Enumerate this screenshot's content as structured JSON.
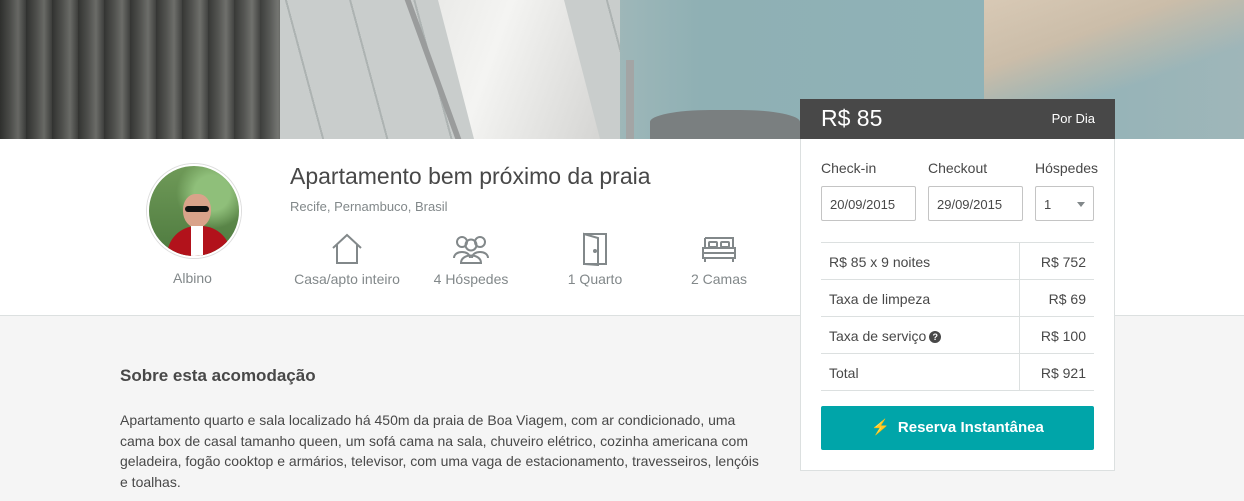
{
  "listing": {
    "title": "Apartamento bem próximo da praia",
    "location": "Recife, Pernambuco, Brasil",
    "host_name": "Albino"
  },
  "amenities": [
    {
      "icon": "house-icon",
      "label": "Casa/apto inteiro"
    },
    {
      "icon": "guests-icon",
      "label": "4 Hóspedes"
    },
    {
      "icon": "door-icon",
      "label": "1 Quarto"
    },
    {
      "icon": "bed-icon",
      "label": "2 Camas"
    }
  ],
  "pricing": {
    "price": "R$ 85",
    "period": "Por Dia"
  },
  "booking": {
    "checkin_label": "Check-in",
    "checkout_label": "Checkout",
    "guests_label": "Hóspedes",
    "checkin_value": "20/09/2015",
    "checkout_value": "29/09/2015",
    "guests_value": "1",
    "rows": [
      {
        "label": "R$ 85 x 9 noites",
        "value": "R$ 752"
      },
      {
        "label": "Taxa de limpeza",
        "value": "R$ 69"
      },
      {
        "label": "Taxa de serviço",
        "value": "R$ 100",
        "help_icon": "?"
      },
      {
        "label": "Total",
        "value": "R$ 921"
      }
    ],
    "button_label": "Reserva Instantânea",
    "button_icon": "lightning-icon",
    "accent_color": "#00a5a9"
  },
  "about": {
    "title": "Sobre esta acomodação",
    "text": "Apartamento quarto e sala localizado há 450m da praia de Boa Viagem, com ar condicionado, uma cama box de casal tamanho queen, um sofá cama na sala, chuveiro elétrico, cozinha americana com geladeira, fogão cooktop e armários, televisor, com uma vaga de estacionamento, travesseiros, lençóis e toalhas."
  }
}
